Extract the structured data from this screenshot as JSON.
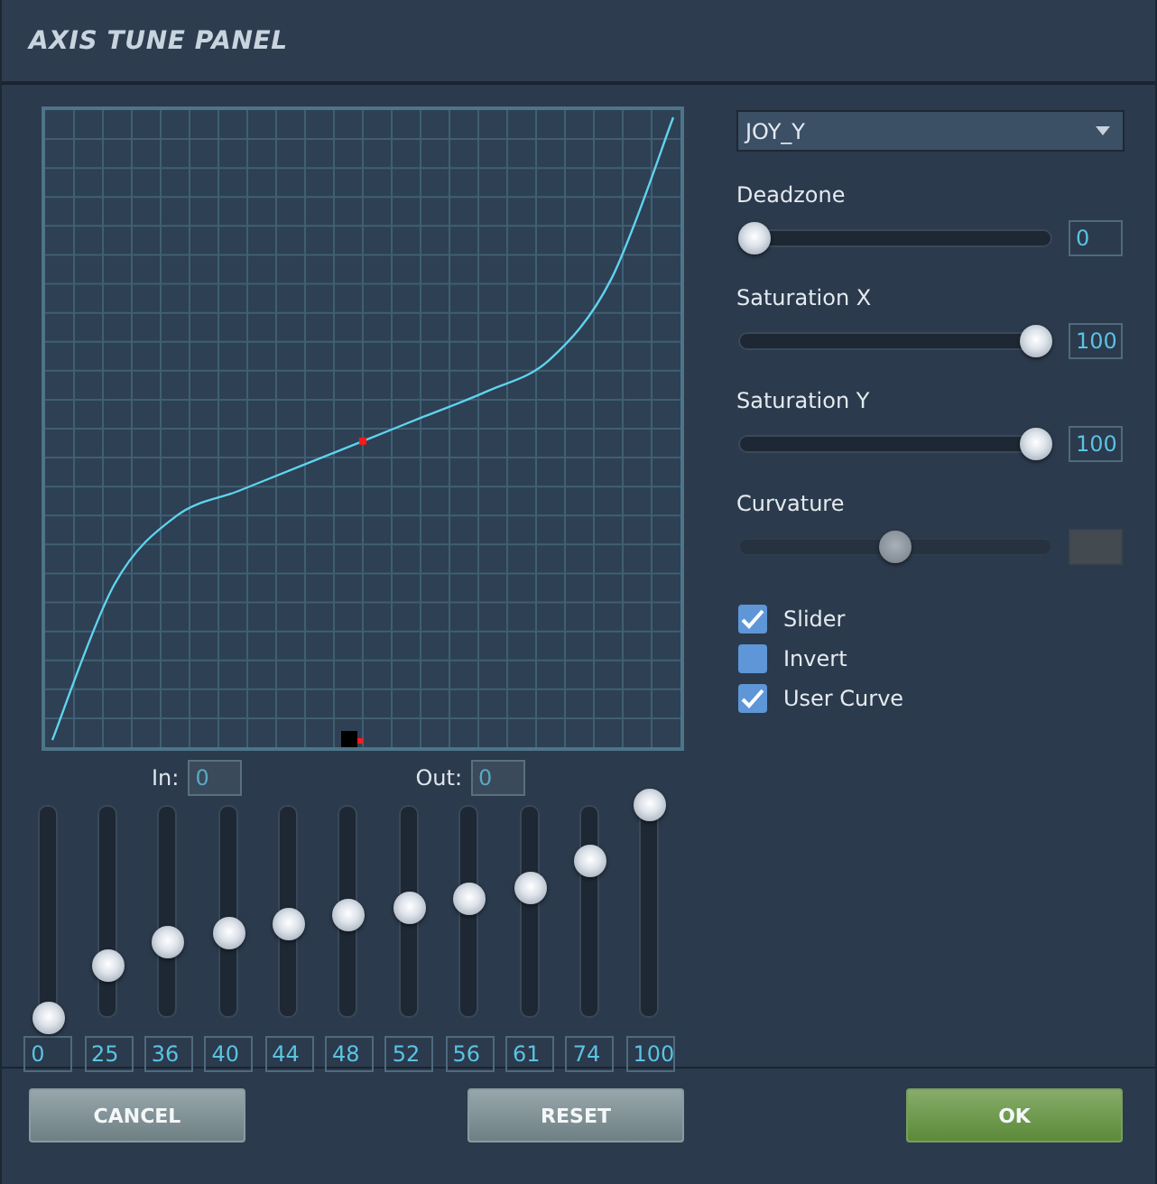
{
  "window": {
    "title": "AXIS TUNE PANEL"
  },
  "axis_select": {
    "value": "JOY_Y"
  },
  "axis_sliders": [
    {
      "label": "Deadzone",
      "level": 0,
      "value": "0",
      "disabled": false
    },
    {
      "label": "Saturation X",
      "level": 1,
      "value": "100",
      "disabled": false
    },
    {
      "label": "Saturation Y",
      "level": 1,
      "value": "100",
      "disabled": false
    },
    {
      "label": "Curvature",
      "level": 0.5,
      "disabled": true
    }
  ],
  "checkboxes": [
    {
      "label": "Slider",
      "checked": true
    },
    {
      "label": "Invert",
      "checked": false
    },
    {
      "label": "User Curve",
      "checked": true
    }
  ],
  "in_field": {
    "label": "In:",
    "value": "0"
  },
  "out_field": {
    "label": "Out:",
    "value": "0"
  },
  "curve_points": [
    {
      "level": 0,
      "value": "0"
    },
    {
      "level": 0.25,
      "value": "25"
    },
    {
      "level": 0.36,
      "value": "36"
    },
    {
      "level": 0.4,
      "value": "40"
    },
    {
      "level": 0.44,
      "value": "44"
    },
    {
      "level": 0.48,
      "value": "48"
    },
    {
      "level": 0.52,
      "value": "52"
    },
    {
      "level": 0.56,
      "value": "56"
    },
    {
      "level": 0.61,
      "value": "61"
    },
    {
      "level": 0.74,
      "value": "74"
    },
    {
      "level": 1,
      "value": "100"
    }
  ],
  "buttons": [
    {
      "label": "CANCEL",
      "kind": "neutral"
    },
    {
      "label": "RESET",
      "kind": "neutral"
    },
    {
      "label": "OK",
      "kind": "primary"
    }
  ]
}
